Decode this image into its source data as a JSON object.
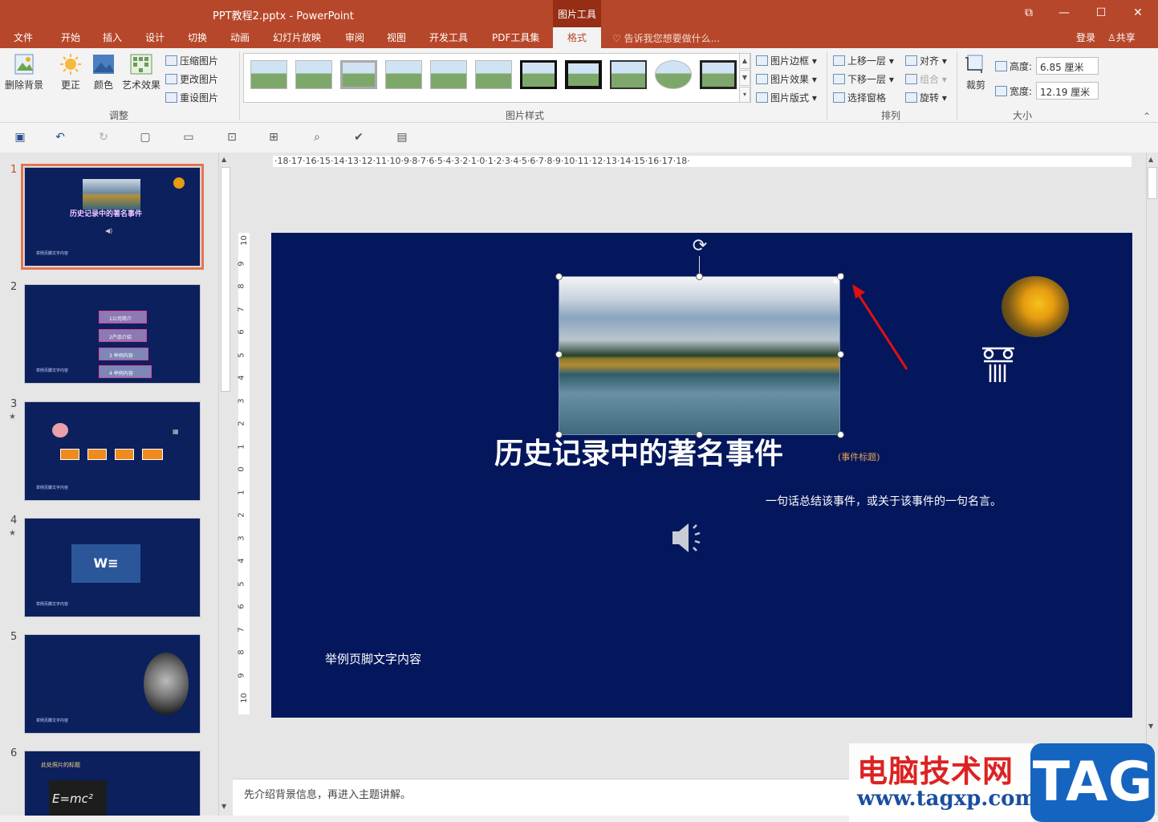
{
  "window": {
    "title": "PPT教程2.pptx - PowerPoint",
    "context_group": "图片工具",
    "min": "—",
    "max": "☐",
    "close": "✕",
    "restore": "⧉"
  },
  "tabs": [
    "文件",
    "开始",
    "插入",
    "设计",
    "切换",
    "动画",
    "幻灯片放映",
    "审阅",
    "视图",
    "开发工具",
    "PDF工具集"
  ],
  "active_tab": "格式",
  "tell_me": "告诉我您想要做什么...",
  "account": {
    "login": "登录",
    "share": "共享"
  },
  "ribbon": {
    "adjust": {
      "remove_bg": "删除背景",
      "correct": "更正",
      "color": "颜色",
      "artistic": "艺术效果",
      "compress": "压缩图片",
      "change": "更改图片",
      "reset": "重设图片",
      "label": "调整"
    },
    "styles": {
      "border": "图片边框",
      "effects": "图片效果",
      "layout": "图片版式",
      "label": "图片样式"
    },
    "arrange": {
      "forward": "上移一层",
      "backward": "下移一层",
      "pane": "选择窗格",
      "align": "对齐",
      "group": "组合",
      "rotate": "旋转",
      "label": "排列"
    },
    "size": {
      "crop": "裁剪",
      "height_label": "高度:",
      "height_value": "6.85 厘米",
      "width_label": "宽度:",
      "width_value": "12.19 厘米",
      "label": "大小"
    }
  },
  "ruler_text": "·18·17·16·15·14·13·12·11·10·9·8·7·6·5·4·3·2·1·0·1·2·3·4·5·6·7·8·9·10·11·12·13·14·15·16·17·18·",
  "vruler": [
    "10",
    "9",
    "8",
    "7",
    "6",
    "5",
    "4",
    "3",
    "2",
    "1",
    "0",
    "1",
    "2",
    "3",
    "4",
    "5",
    "6",
    "7",
    "8",
    "9",
    "10"
  ],
  "thumbnails": [
    {
      "num": "1",
      "title": "历史记录中的著名事件",
      "footer": "举例页脚文字内容"
    },
    {
      "num": "2",
      "items": [
        "1公司简介",
        "2产品介绍",
        "3 举例内容",
        "4 举例内容"
      ],
      "footer": "举例页脚文字内容"
    },
    {
      "num": "3",
      "footer": "举例页脚文字内容"
    },
    {
      "num": "4",
      "footer": "举例页脚文字内容"
    },
    {
      "num": "5",
      "footer": "举例页脚文字内容"
    },
    {
      "num": "6",
      "title": "此处照片的标题",
      "formula": "E=mc²"
    }
  ],
  "slide": {
    "title": "历史记录中的著名事件",
    "title_sub": "(事件标题)",
    "quote": "一句话总结该事件，或关于该事件的一句名言。",
    "footer": "举例页脚文字内容"
  },
  "notes": "先介绍背景信息，再进入主题讲解。",
  "watermark": {
    "cn": "电脑技术网",
    "url": "www.tagxp.com",
    "tag": "TAG"
  },
  "colors": {
    "accent": "#b7472a",
    "slide_bg": "#04175c",
    "selection": "#e77350"
  }
}
